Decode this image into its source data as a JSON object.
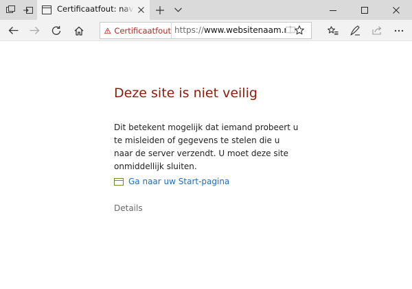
{
  "tab": {
    "title": "Certificaatfout: navigatie"
  },
  "address_bar": {
    "warning_label": "Certificaatfout",
    "url_scheme": "https://",
    "url_host": "www.websitenaam.nl"
  },
  "page": {
    "title": "Deze site is niet veilig",
    "body": "Dit betekent mogelijk dat iemand probeert u te misleiden of gegevens te stelen die u naar de server verzendt. U moet deze site onmiddellijk sluiten.",
    "home_link": "Ga naar uw Start-pagina",
    "details": "Details"
  },
  "colors": {
    "title": "#8a1c0c",
    "warning": "#b0271c",
    "link": "#1c6ebf",
    "home_icon": "#6b8e23"
  },
  "icons": {
    "tabstrip": [
      "tab-previews-icon",
      "set-aside-tabs-icon"
    ],
    "tab": [
      "page-icon",
      "close-icon"
    ],
    "tabstrip_right": [
      "plus-icon",
      "chevron-down-icon"
    ],
    "window": [
      "minimize-icon",
      "maximize-icon",
      "close-icon"
    ],
    "navigation": [
      "back-arrow-icon",
      "forward-arrow-icon",
      "refresh-icon",
      "home-icon"
    ],
    "address_bar": [
      "warning-triangle-icon",
      "reading-view-icon",
      "star-icon"
    ],
    "toolbar": [
      "favorites-hub-icon",
      "pen-notes-icon",
      "share-icon",
      "more-icon"
    ],
    "page": [
      "start-page-icon"
    ]
  }
}
